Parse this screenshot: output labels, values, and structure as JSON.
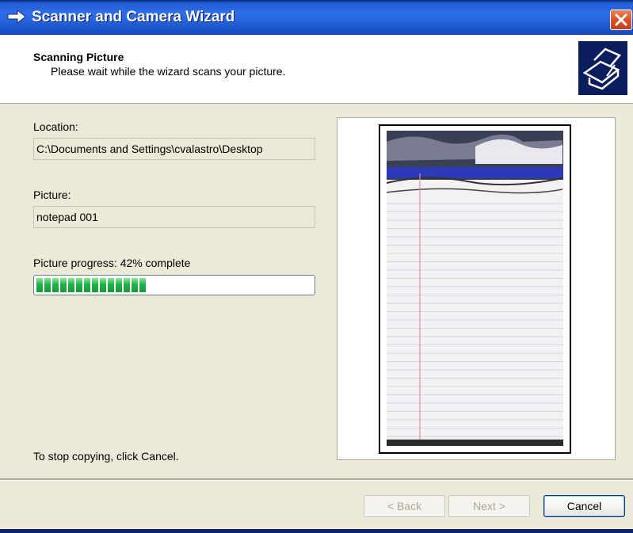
{
  "window": {
    "title": "Scanner and Camera Wizard"
  },
  "header": {
    "title": "Scanning Picture",
    "subtitle": "Please wait while the wizard scans your picture.",
    "icon": "scanner-wizard-icon"
  },
  "fields": {
    "location_label": "Location:",
    "location_value": "C:\\Documents and Settings\\cvalastro\\Desktop",
    "picture_label": "Picture:",
    "picture_value": "notepad 001"
  },
  "progress": {
    "label": "Picture progress: 42% complete",
    "percent": 42,
    "color": "#22b14c"
  },
  "instructions": "To stop copying, click Cancel.",
  "preview": {
    "description_icon": "scanned-notepad-image"
  },
  "buttons": {
    "back": "< Back",
    "next": "Next >",
    "cancel": "Cancel"
  }
}
